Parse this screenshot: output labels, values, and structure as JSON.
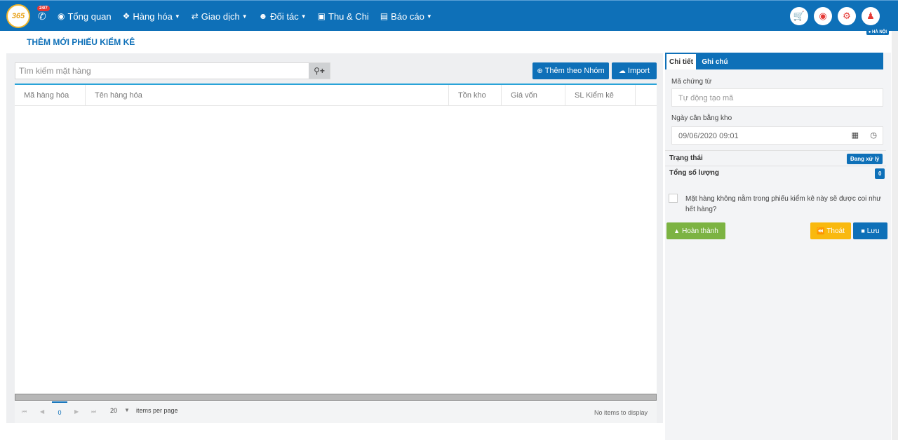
{
  "navbar": {
    "logo_text": "365",
    "hotline_badge": "24/7",
    "items": [
      {
        "label": "Tổng quan",
        "icon": "dashboard-icon",
        "dropdown": false
      },
      {
        "label": "Hàng hóa",
        "icon": "cubes-icon",
        "dropdown": true
      },
      {
        "label": "Giao dịch",
        "icon": "exchange-icon",
        "dropdown": true
      },
      {
        "label": "Đối tác",
        "icon": "users-icon",
        "dropdown": true
      },
      {
        "label": "Thu & Chi",
        "icon": "money-icon",
        "dropdown": false
      },
      {
        "label": "Báo cáo",
        "icon": "bar-chart-icon",
        "dropdown": true
      }
    ],
    "right_icons": [
      "cart-icon",
      "location-pin-icon",
      "gear-icon",
      "user-icon"
    ],
    "region": "HÀ NỘI"
  },
  "page": {
    "title": "THÊM MỚI PHIẾU KIỂM KÊ"
  },
  "search": {
    "placeholder": "Tìm kiếm mặt hàng"
  },
  "toolbar": {
    "add_group_label": "Thêm theo Nhóm",
    "import_label": "Import"
  },
  "grid": {
    "columns": [
      "Mã hàng hóa",
      "Tên hàng hóa",
      "Tồn kho",
      "Giá vốn",
      "SL Kiểm kê"
    ],
    "rows": []
  },
  "pager": {
    "page": "0",
    "page_size": "20",
    "per_page_label": "items per page",
    "empty_text": "No items to display"
  },
  "detail": {
    "tab_detail": "Chi tiết",
    "tab_note": "Ghi chú",
    "doc_code_label": "Mã chứng từ",
    "doc_code_placeholder": "Tự động tạo mã",
    "date_label": "Ngày cân bằng kho",
    "date_value": "09/06/2020 09:01",
    "status_label": "Trạng thái",
    "status_value": "Đang xử lý",
    "total_label": "Tổng số lượng",
    "total_value": "0",
    "checkbox_text": "Mặt hàng không nằm trong phiếu kiểm kê này sẽ được coi như hết hàng?",
    "complete_label": "Hoàn thành",
    "exit_label": "Thoát",
    "save_label": "Lưu"
  },
  "colors": {
    "primary": "#0e70b8",
    "success": "#7cb342",
    "warning": "#f9b90f",
    "danger": "#e53935"
  }
}
